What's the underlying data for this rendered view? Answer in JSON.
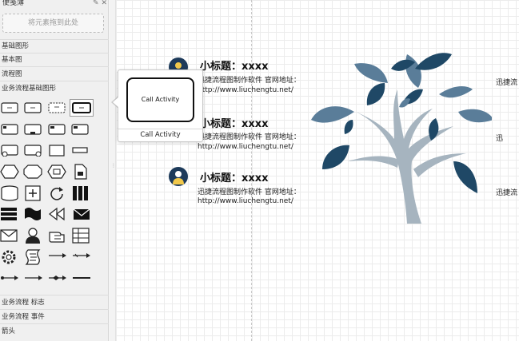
{
  "sidebar": {
    "header_label": "便笺薄",
    "header_tools": "✎ ✕",
    "dropzone_text": "将元素拖到此处",
    "categories_top": [
      "基础图形",
      "基本图",
      "流程图",
      "业务流程基础图形"
    ],
    "categories_bottom": [
      "业务流程 标志",
      "业务流程 事件",
      "箭头"
    ]
  },
  "tooltip": {
    "shape_label": "Call Activity",
    "caption": "Call Activity"
  },
  "canvas": {
    "items": [
      {
        "title": "小标题：xxxx",
        "line1": "迅捷流程图制作软件 官网地址：",
        "line2": "http://www.liuchengtu.net/"
      },
      {
        "title": "小标题：xxxx",
        "line1": "迅捷流程图制作软件 官网地址：",
        "line2": "http://www.liuchengtu.net/"
      },
      {
        "title": "小标题：xxxx",
        "line1": "迅捷流程图制作软件 官网地址：",
        "line2": "http://www.liuchengtu.net/"
      }
    ],
    "right_texts": [
      "迅捷流",
      "迅",
      "迅捷流"
    ],
    "tree_trunk_color": "#a6b4bf",
    "leaf_colors": [
      "#1f4866",
      "#5a7d99"
    ]
  }
}
